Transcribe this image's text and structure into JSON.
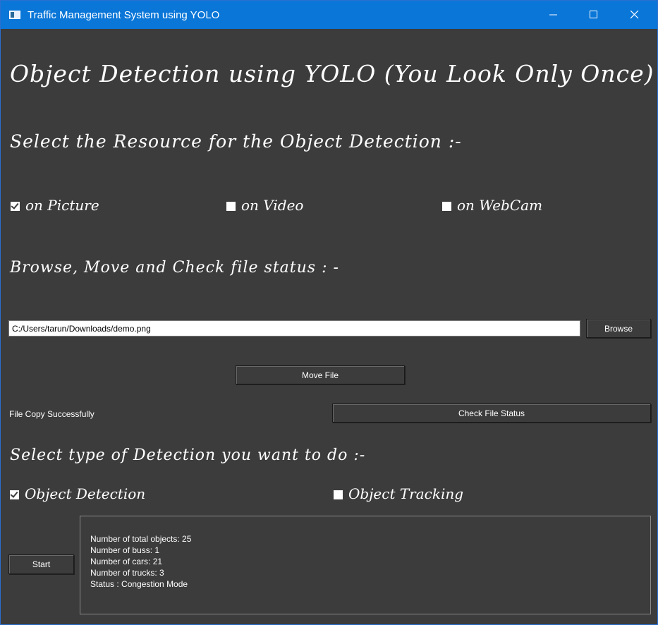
{
  "window": {
    "title": "Traffic Management System using YOLO"
  },
  "main": {
    "heading": "Object Detection using YOLO (You Look Only Once)",
    "resource_heading": "Select the Resource for the Object Detection :-",
    "resources": [
      {
        "label": "on Picture",
        "checked": true
      },
      {
        "label": "on Video",
        "checked": false
      },
      {
        "label": "on WebCam",
        "checked": false
      }
    ],
    "file_heading": "Browse, Move and Check file status : -",
    "file_path": "C:/Users/tarun/Downloads/demo.png",
    "browse_label": "Browse",
    "move_label": "Move File",
    "file_status": "File Copy Successfully",
    "check_label": "Check File Status",
    "detection_heading": "Select type of Detection you want to do :-",
    "detection_types": [
      {
        "label": "Object Detection",
        "checked": true
      },
      {
        "label": "Object Tracking",
        "checked": false
      }
    ],
    "start_label": "Start",
    "results": [
      "Number of total objects: 25",
      "Number of buss: 1",
      "Number of cars: 21",
      "Number of trucks: 3",
      "Status : Congestion Mode"
    ]
  },
  "colors": {
    "titlebar": "#0a76d8",
    "background": "#3c3c3c",
    "text": "#ffffff"
  }
}
